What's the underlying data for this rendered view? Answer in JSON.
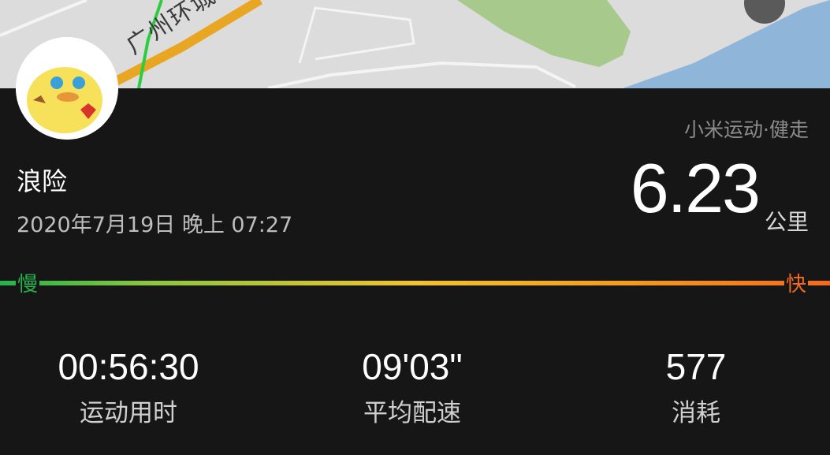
{
  "map": {
    "road_label": "广州环城高速",
    "colors": {
      "land": "#dcdcdc",
      "park": "#a8c98c",
      "water": "#8fb6d8",
      "track": "#2ecc40"
    }
  },
  "profile": {
    "avatar_icon": "cartoon-duck-avatar",
    "name": "浪险",
    "datetime": "2020年7月19日 晚上 07:27"
  },
  "activity": {
    "app_tag": "小米运动·健走",
    "distance": "6.23",
    "distance_unit": "公里"
  },
  "pace_scale": {
    "slow_label": "慢",
    "fast_label": "快",
    "colors": {
      "slow": "#24b24d",
      "mid": "#f1c232",
      "fast": "#f36a1f"
    }
  },
  "stats": [
    {
      "value": "00:56:30",
      "label": "运动用时"
    },
    {
      "value": "09'03\"",
      "label": "平均配速"
    },
    {
      "value": "577",
      "label": "消耗"
    }
  ]
}
